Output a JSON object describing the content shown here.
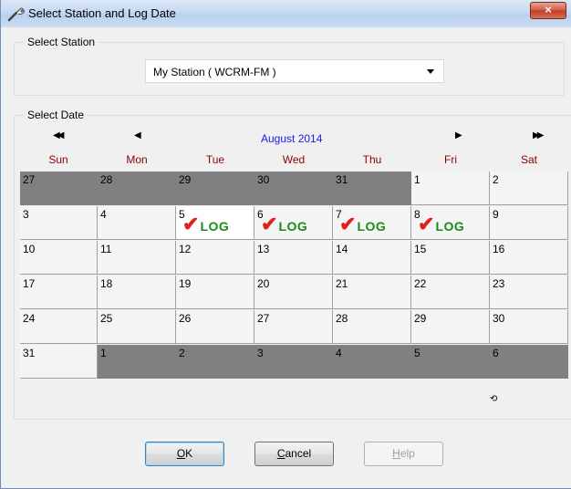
{
  "window": {
    "title": "Select Station and Log Date",
    "close_label": "×"
  },
  "station_group": {
    "label": "Select Station",
    "selected": "My Station ( WCRM-FM )"
  },
  "date_group": {
    "label": "Select Date"
  },
  "calendar": {
    "prev_year_label": "◀◀",
    "prev_month_label": "◀",
    "month_title": "August 2014",
    "next_month_label": "▶",
    "next_year_label": "▶▶",
    "weekdays": [
      "Sun",
      "Mon",
      "Tue",
      "Wed",
      "Thu",
      "Fri",
      "Sat"
    ],
    "weeks": [
      [
        {
          "d": "27",
          "out": true
        },
        {
          "d": "28",
          "out": true
        },
        {
          "d": "29",
          "out": true
        },
        {
          "d": "30",
          "out": true
        },
        {
          "d": "31",
          "out": true
        },
        {
          "d": "1"
        },
        {
          "d": "2"
        }
      ],
      [
        {
          "d": "3"
        },
        {
          "d": "4"
        },
        {
          "d": "5",
          "log": true,
          "today": true
        },
        {
          "d": "6",
          "log": true
        },
        {
          "d": "7",
          "log": true
        },
        {
          "d": "8",
          "log": true
        },
        {
          "d": "9"
        }
      ],
      [
        {
          "d": "10"
        },
        {
          "d": "11"
        },
        {
          "d": "12"
        },
        {
          "d": "13"
        },
        {
          "d": "14"
        },
        {
          "d": "15"
        },
        {
          "d": "16"
        }
      ],
      [
        {
          "d": "17"
        },
        {
          "d": "18"
        },
        {
          "d": "19"
        },
        {
          "d": "20"
        },
        {
          "d": "21"
        },
        {
          "d": "22"
        },
        {
          "d": "23"
        }
      ],
      [
        {
          "d": "24"
        },
        {
          "d": "25"
        },
        {
          "d": "26"
        },
        {
          "d": "27"
        },
        {
          "d": "28"
        },
        {
          "d": "29"
        },
        {
          "d": "30"
        }
      ],
      [
        {
          "d": "31"
        },
        {
          "d": "1",
          "out": true
        },
        {
          "d": "2",
          "out": true
        },
        {
          "d": "3",
          "out": true
        },
        {
          "d": "4",
          "out": true
        },
        {
          "d": "5",
          "out": true
        },
        {
          "d": "6",
          "out": true
        }
      ]
    ],
    "log_mark": "✔",
    "log_label": "LOG",
    "refresh_label": "⟲"
  },
  "buttons": {
    "ok_label": "OK",
    "ok_mnemonic": "O",
    "ok_rest": "K",
    "cancel_mnemonic": "C",
    "cancel_rest": "ancel",
    "help_mnemonic": "H",
    "help_rest": "elp"
  },
  "colors": {
    "weekday": "#8b0000",
    "month_title": "#1a1ae6",
    "out_of_month": "#808080",
    "log_check": "#e0201a",
    "log_text": "#1a8a1a"
  }
}
